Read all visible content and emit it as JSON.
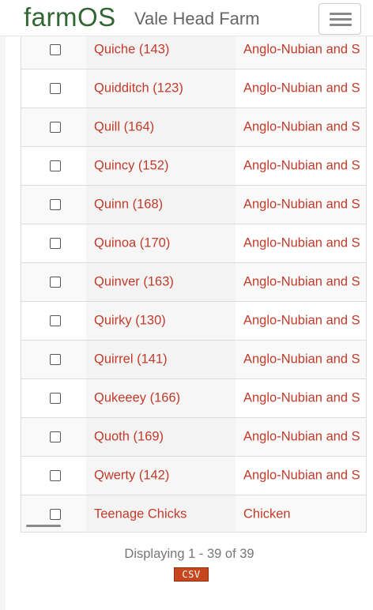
{
  "header": {
    "logo": "farmOS",
    "site_name": "Vale Head Farm",
    "menu_icon": "hamburger-icon"
  },
  "table": {
    "rows": [
      {
        "name": "Quiche (143)",
        "type": "Anglo-Nubian and S"
      },
      {
        "name": "Quidditch (123)",
        "type": "Anglo-Nubian and S"
      },
      {
        "name": "Quill (164)",
        "type": "Anglo-Nubian and S"
      },
      {
        "name": "Quincy (152)",
        "type": "Anglo-Nubian and S"
      },
      {
        "name": "Quinn (168)",
        "type": "Anglo-Nubian and S"
      },
      {
        "name": "Quinoa (170)",
        "type": "Anglo-Nubian and S"
      },
      {
        "name": "Quinver (163)",
        "type": "Anglo-Nubian and S"
      },
      {
        "name": "Quirky (130)",
        "type": "Anglo-Nubian and S"
      },
      {
        "name": "Quirrel (141)",
        "type": "Anglo-Nubian and S"
      },
      {
        "name": "Qukeeey (166)",
        "type": "Anglo-Nubian and S"
      },
      {
        "name": "Quoth (169)",
        "type": "Anglo-Nubian and S"
      },
      {
        "name": "Qwerty (142)",
        "type": "Anglo-Nubian and S"
      },
      {
        "name": "Teenage Chicks",
        "type": "Chicken"
      }
    ]
  },
  "footer": {
    "displaying": "Displaying 1 - 39 of 39",
    "csv_label": "CSV"
  },
  "colors": {
    "link": "#c23b2a",
    "brand": "#336633",
    "csv_bg": "#c8461d"
  }
}
